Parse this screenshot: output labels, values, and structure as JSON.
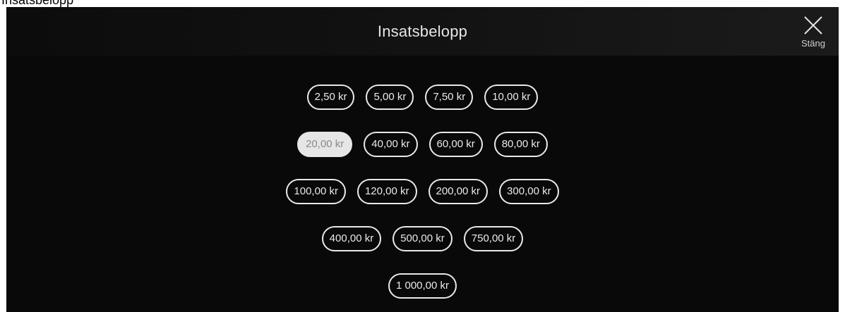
{
  "page": {
    "top_title": "Insatsbelopp"
  },
  "modal": {
    "title": "Insatsbelopp",
    "close_label": "Stäng"
  },
  "stake_rows": [
    [
      "2,50 kr",
      "5,00 kr",
      "7,50 kr",
      "10,00 kr"
    ],
    [
      "20,00 kr",
      "40,00 kr",
      "60,00 kr",
      "80,00 kr"
    ],
    [
      "100,00 kr",
      "120,00 kr",
      "200,00 kr",
      "300,00 kr"
    ],
    [
      "400,00 kr",
      "500,00 kr",
      "750,00 kr"
    ],
    [
      "1 000,00 kr"
    ]
  ],
  "selected_amount": "20,00 kr",
  "colors": {
    "background": "#090909",
    "pill_border": "#e9e9e9",
    "selected_fill": "#e6e6e6",
    "selected_text": "#8a8a8a"
  }
}
